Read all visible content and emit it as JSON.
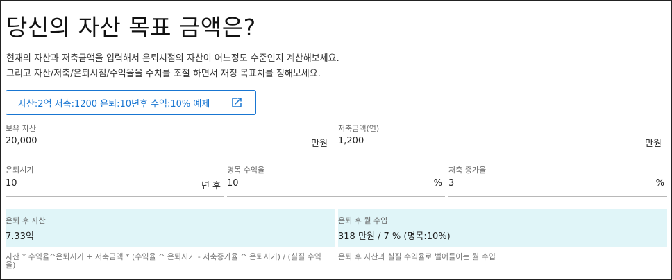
{
  "page": {
    "title": "당신의 자산 목표 금액은?",
    "description_line1": "현재의 자산과 저축금액을 입력해서 은퇴시점의 자산이 어느정도 수준인지 계산해보세요.",
    "description_line2": "그리고 자산/저축/은퇴시점/수익율을 수치를 조절 하면서 재정 목표치를 정해보세요."
  },
  "example_button": {
    "label": "자산:2억 저축:1200 은퇴:10년후 수익:10% 예제",
    "icon": "open-in-new-icon",
    "color": "#1976d2"
  },
  "fields": {
    "assets": {
      "label": "보유 자산",
      "value": "20,000",
      "unit": "만원"
    },
    "savings": {
      "label": "저축금액(연)",
      "value": "1,200",
      "unit": "만원"
    },
    "retire_years": {
      "label": "은퇴시기",
      "value": "10",
      "unit": "년 후"
    },
    "nominal_return": {
      "label": "명목 수익율",
      "value": "10",
      "unit": "%"
    },
    "savings_growth": {
      "label": "저축 증가율",
      "value": "3",
      "unit": "%"
    }
  },
  "results": {
    "assets_after": {
      "label": "은퇴 후 자산",
      "value": "7.33억",
      "helper": "자산 * 수익율^은퇴시기 + 저축금액 * (수익율 ^ 은퇴시기 - 저축증가율 ^ 은퇴시기) / (실질 수익율)"
    },
    "monthly_income": {
      "label": "은퇴 후 월 수입",
      "value": "318 만원 / 7 % (명목:10%)",
      "helper": "은퇴 후 자산과 실질 수익율로 벌어들이는 월 수입"
    }
  },
  "colors": {
    "accent": "#1976d2",
    "result_bg": "#e0f5f8"
  }
}
